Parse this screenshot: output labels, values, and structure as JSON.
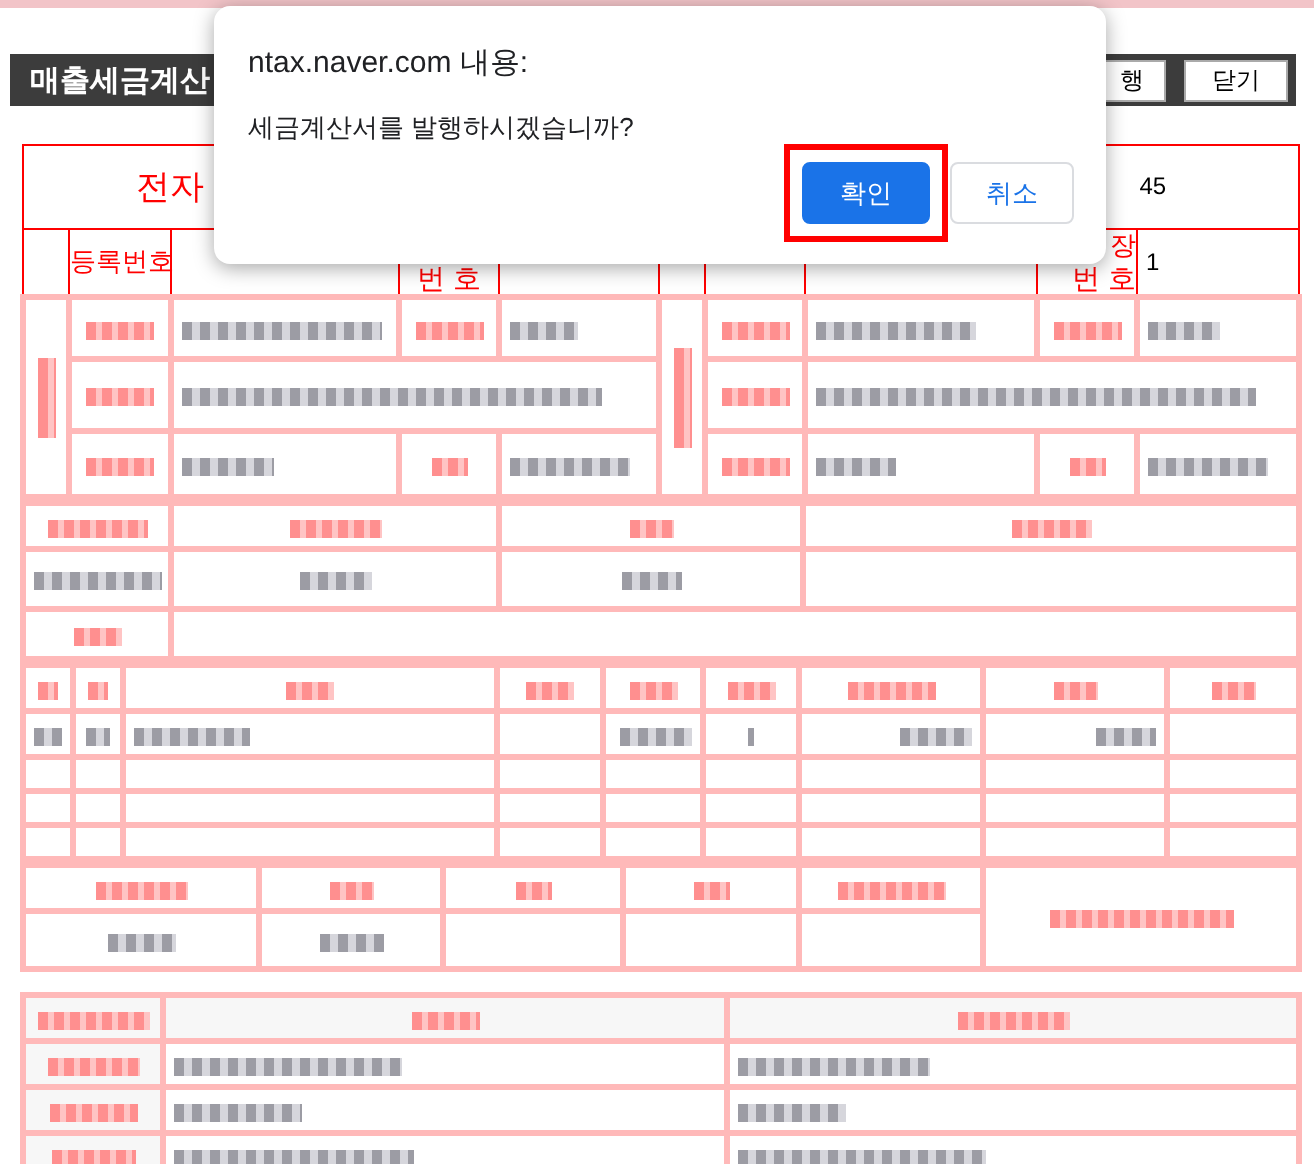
{
  "header": {
    "title": "매출세금계산",
    "buttons": [
      {
        "label": "행",
        "kind": "partial"
      },
      {
        "label": "닫기",
        "kind": "full"
      }
    ]
  },
  "invoice": {
    "title": "전자",
    "number": "45",
    "supplier": {
      "label": "등록번호",
      "branch_label": "번 호"
    },
    "buyer": {
      "branch_label_top": "장",
      "branch_label": "번 호",
      "branch_number": "1"
    }
  },
  "dialog": {
    "title": "ntax.naver.com 내용:",
    "message": "세금계산서를 발행하시겠습니까?",
    "buttons": [
      {
        "label": "확인",
        "kind": "primary",
        "highlighted": true
      },
      {
        "label": "취소",
        "kind": "secondary",
        "highlighted": false
      }
    ]
  }
}
